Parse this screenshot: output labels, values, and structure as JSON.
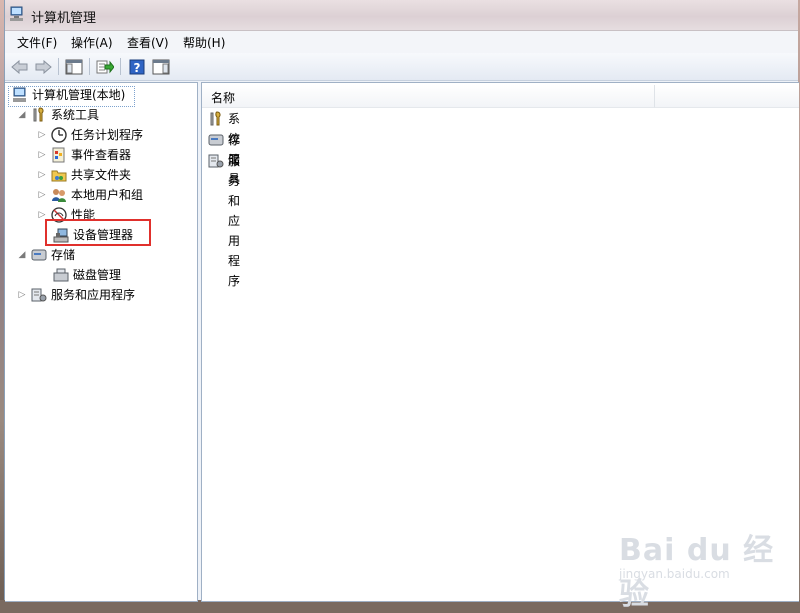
{
  "window": {
    "title": "计算机管理"
  },
  "menu": [
    "文件(F)",
    "操作(A)",
    "查看(V)",
    "帮助(H)"
  ],
  "toolbar": {
    "buttons": [
      "back-icon",
      "forward-icon",
      "show-hide-console-tree-icon",
      "export-list-icon",
      "help-icon",
      "show-hide-action-pane-icon"
    ]
  },
  "tree": {
    "root": "计算机管理(本地)",
    "system_tools": {
      "label": "系统工具",
      "children": {
        "task_scheduler": "任务计划程序",
        "event_viewer": "事件查看器",
        "shared_folders": "共享文件夹",
        "local_users": "本地用户和组",
        "performance": "性能",
        "device_manager": "设备管理器"
      }
    },
    "storage": {
      "label": "存储",
      "disk_management": "磁盘管理"
    },
    "services": "服务和应用程序"
  },
  "list": {
    "header_name": "名称",
    "items": [
      "系统工具",
      "存储",
      "服务和应用程序"
    ]
  },
  "watermark": {
    "logo": "Bai du 经验",
    "url": "jingyan.baidu.com"
  }
}
